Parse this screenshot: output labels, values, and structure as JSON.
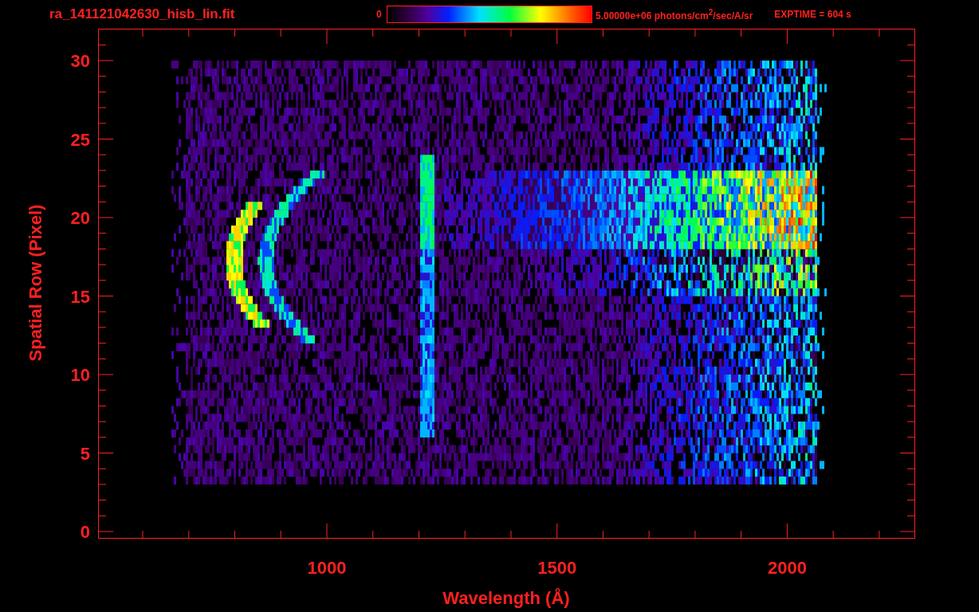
{
  "header": {
    "file_title": "ra_141121042630_hisb_lin.fit",
    "colorbar_min": "0",
    "colorbar_max": "5.00000e+06 photons/cm$^{2}$/sec/A/sr",
    "exposure": "EXPTIME = 604 s"
  },
  "x_axis": {
    "label": "Wavelength (Å)",
    "ticks": [
      "1000",
      "1500",
      "2000"
    ]
  },
  "y_axis": {
    "label": "Spatial Row (Pixel)",
    "ticks": [
      "30",
      "25",
      "20",
      "15",
      "10",
      "5",
      "0"
    ]
  }
}
